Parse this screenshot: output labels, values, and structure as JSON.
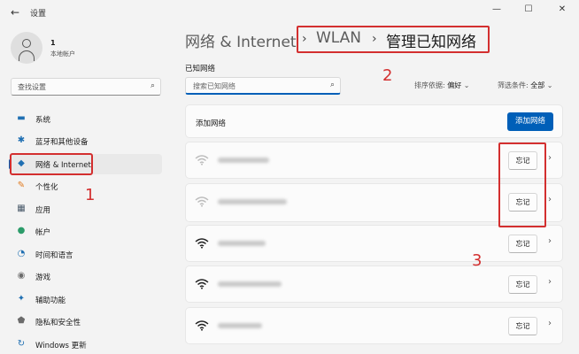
{
  "titlebar": {
    "back_icon": "back-arrow-icon",
    "title": "设置",
    "minimize": "—",
    "maximize": "☐",
    "close": "✕"
  },
  "account": {
    "name": "1",
    "type": "本地帐户"
  },
  "search": {
    "placeholder": "查找设置",
    "icon": "search-icon"
  },
  "sidebar": {
    "items": [
      {
        "label": "系统",
        "icon": "monitor-icon",
        "glyph": "▬",
        "color": "#1f6fb2"
      },
      {
        "label": "蓝牙和其他设备",
        "icon": "bluetooth-icon",
        "glyph": "✱",
        "color": "#1f6fb2"
      },
      {
        "label": "网络 & Internet",
        "icon": "wifi-diamond-icon",
        "glyph": "◆",
        "color": "#1f6fb2",
        "active": true
      },
      {
        "label": "个性化",
        "icon": "brush-icon",
        "glyph": "✎",
        "color": "#e07a1f"
      },
      {
        "label": "应用",
        "icon": "apps-icon",
        "glyph": "▦",
        "color": "#4a5a6a"
      },
      {
        "label": "帐户",
        "icon": "person-icon",
        "glyph": "●",
        "color": "#2c9c6a"
      },
      {
        "label": "时间和语言",
        "icon": "globe-clock-icon",
        "glyph": "◔",
        "color": "#1f6fb2"
      },
      {
        "label": "游戏",
        "icon": "gamepad-icon",
        "glyph": "◉",
        "color": "#6b6b6b"
      },
      {
        "label": "辅助功能",
        "icon": "accessibility-icon",
        "glyph": "✦",
        "color": "#1f6fb2"
      },
      {
        "label": "隐私和安全性",
        "icon": "shield-icon",
        "glyph": "⬟",
        "color": "#6b6b6b"
      },
      {
        "label": "Windows 更新",
        "icon": "update-icon",
        "glyph": "↻",
        "color": "#1f6fb2"
      }
    ]
  },
  "breadcrumb": {
    "part1": "网络 & Internet",
    "sep": "›",
    "part2": "WLAN",
    "part3": "管理已知网络"
  },
  "known": {
    "title": "已知网络",
    "filter_placeholder": "搜索已知网络",
    "sort_label": "排序依据:",
    "sort_value": "偏好",
    "filter_label": "筛选条件:",
    "filter_value": "全部"
  },
  "add_network": {
    "label": "添加网络",
    "button": "添加网络"
  },
  "networks": [
    {
      "forget": "忘记"
    },
    {
      "forget": "忘记"
    },
    {
      "forget": "忘记"
    },
    {
      "forget": "忘记"
    },
    {
      "forget": "忘记"
    }
  ],
  "annotations": {
    "one": "1",
    "two": "2",
    "three": "3"
  },
  "colors": {
    "accent": "#005fb8",
    "annotation": "#d32f2f"
  }
}
